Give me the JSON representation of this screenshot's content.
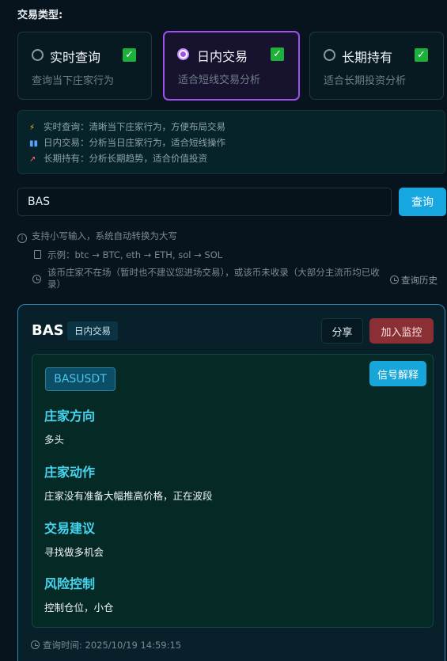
{
  "trade_type_label": "交易类型:",
  "trade_types": [
    {
      "title": "实时查询",
      "desc": "查询当下庄家行为",
      "selected": false,
      "checked": true
    },
    {
      "title": "日内交易",
      "desc": "适合短线交易分析",
      "selected": true,
      "checked": true
    },
    {
      "title": "长期持有",
      "desc": "适合长期投资分析",
      "selected": false,
      "checked": true
    }
  ],
  "tips": [
    {
      "icon": "lightning-icon",
      "text": "实时查询：清晰当下庄家行为，方便布局交易"
    },
    {
      "icon": "bar-chart-icon",
      "text": "日内交易：分析当日庄家行为，适合短线操作"
    },
    {
      "icon": "trend-chart-icon",
      "text": "长期持有：分析长期趋势，适合价值投资"
    }
  ],
  "search": {
    "value": "BAS",
    "button_label": "查询"
  },
  "hints": {
    "lowercase": "支持小写输入，系统自动转换为大写",
    "example": "示例：btc → BTC, eth → ETH, sol → SOL",
    "notice": "该币庄家不在场（暂时也不建议您进场交易），或该币未收录（大部分主流币均已收录）",
    "history_link": "查询历史"
  },
  "result": {
    "coin": "BAS",
    "mode_badge": "日内交易",
    "share_label": "分享",
    "watch_label": "加入监控",
    "symbol": "BASUSDT",
    "signal_label": "信号解释",
    "sections": [
      {
        "title": "庄家方向",
        "text": "多头"
      },
      {
        "title": "庄家动作",
        "text": "庄家没有准备大幅推高价格，正在波段"
      },
      {
        "title": "交易建议",
        "text": "寻找做多机会"
      },
      {
        "title": "风险控制",
        "text": "控制仓位，小仓"
      }
    ],
    "query_time": "查询时间: 2025/10/19 14:59:15"
  },
  "colors": {
    "accent_purple": "#a24ff0",
    "accent_blue": "#17a7e0",
    "section_title": "#45d5f0",
    "watch_red": "#8a2f34",
    "check_green": "#1bb13a"
  }
}
